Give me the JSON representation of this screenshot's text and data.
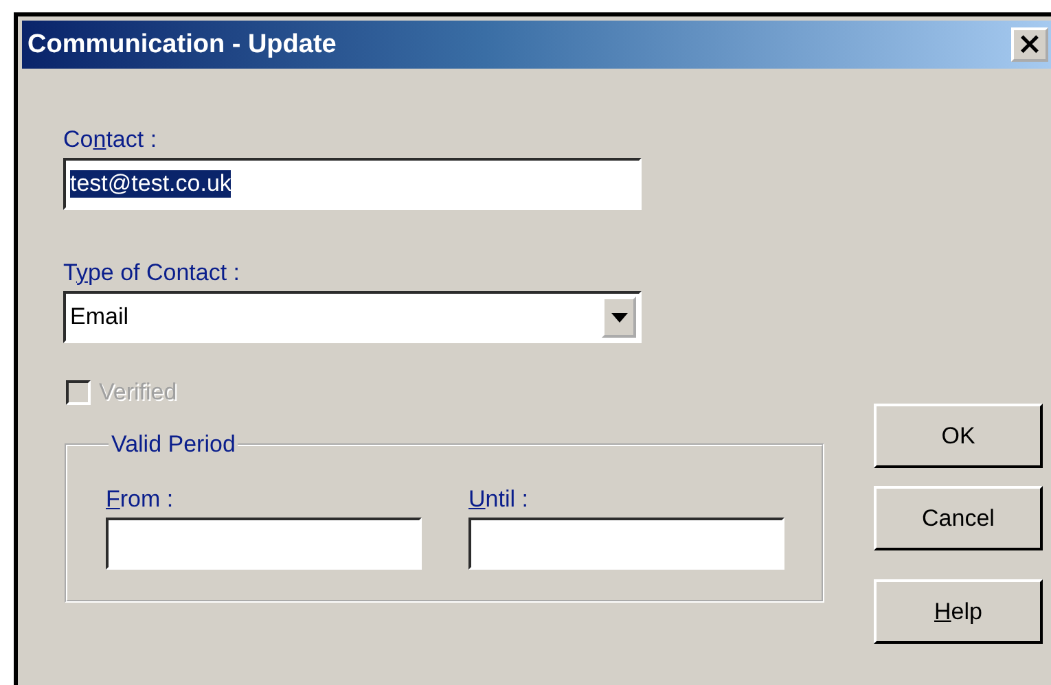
{
  "window": {
    "title": "Communication - Update",
    "close": "×"
  },
  "contact": {
    "label": {
      "before": "Co",
      "underlined": "n",
      "after": "tact :"
    },
    "value": "test@test.co.uk",
    "text_selected": true
  },
  "type_of_contact": {
    "label": {
      "before": "T",
      "underlined": "y",
      "after": "pe of Contact :"
    },
    "value": "Email"
  },
  "verified": {
    "label": "Verified",
    "checked": false,
    "disabled": true
  },
  "valid_period": {
    "title": "Valid Period",
    "fields": [
      {
        "label": {
          "underlined": "F",
          "after": "rom :"
        }
      },
      {
        "label": {
          "underlined": "U",
          "after": "ntil :"
        }
      }
    ]
  },
  "buttons": [
    {
      "label": {
        "before": "OK"
      }
    },
    {
      "label": {
        "before": "Cancel"
      }
    },
    {
      "label": {
        "underlined": "H",
        "after": "elp"
      }
    }
  ]
}
